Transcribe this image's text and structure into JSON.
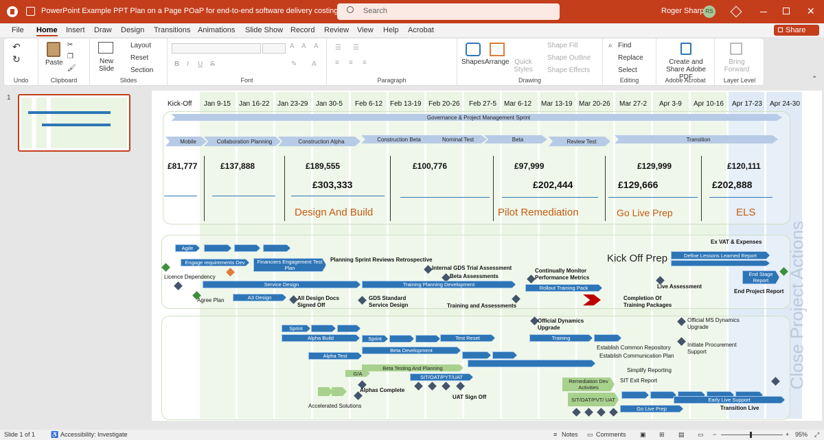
{
  "titlebar": {
    "doc_title": "PowerPoint  Example PPT Plan on a Page POaP for end-to-end software delivery costing  -  PowerPoint",
    "search_placeholder": "Search",
    "user_name": "Roger Sharp",
    "user_initials": "RS"
  },
  "menu": {
    "tabs": [
      "File",
      "Home",
      "Insert",
      "Draw",
      "Design",
      "Transitions",
      "Animations",
      "Slide Show",
      "Record",
      "Review",
      "View",
      "Help",
      "Acrobat"
    ],
    "share_label": "Share"
  },
  "ribbon": {
    "undo_label": "Undo",
    "clipboard": {
      "paste": "Paste",
      "group": "Clipboard"
    },
    "slides": {
      "new_slide": "New Slide",
      "layout": "Layout",
      "reset": "Reset",
      "section": "Section",
      "group": "Slides"
    },
    "font": {
      "group": "Font"
    },
    "paragraph": {
      "group": "Paragraph"
    },
    "drawing": {
      "shapes": "Shapes",
      "arrange": "Arrange",
      "quick_styles": "Quick Styles",
      "shape_fill": "Shape Fill",
      "shape_outline": "Shape Outline",
      "shape_effects": "Shape Effects",
      "group": "Drawing"
    },
    "editing": {
      "find": "Find",
      "replace": "Replace",
      "select": "Select",
      "group": "Editing"
    },
    "acrobat": {
      "create": "Create and Share Adobe PDF",
      "group": "Adobe Acrobat"
    },
    "layer": {
      "bring_forward": "Bring Forward",
      "group": "Layer Level"
    }
  },
  "thumb": {
    "number": "1"
  },
  "slide": {
    "headers": [
      "Kick-Off",
      "Jan 9-15",
      "Jan 16-22",
      "Jan 23-29",
      "Jan 30-5",
      "Feb 6-12",
      "Feb 13-19",
      "Feb 20-26",
      "Feb 27-5",
      "Mar 6-12",
      "Mar 13-19",
      "Mar 20-26",
      "Mar 27-2",
      "Apr 3-9",
      "Apr 10-16",
      "Apr 17-23",
      "Apr 24-30"
    ],
    "governance": "Governance & Project Management Sprint",
    "phases_row": [
      "Mobile",
      "Collaboration Planning",
      "Construction Alpha",
      "Construction Beta",
      "Nominal Test",
      "Beta",
      "Review Test",
      "Transition"
    ],
    "costs_small": [
      "£81,777",
      "£137,888",
      "£189,555",
      "£100,776",
      "£97,999",
      "£129,999",
      "£120,111"
    ],
    "costs_big": [
      "£303,333",
      "£202,444",
      "£129,666",
      "£202,888"
    ],
    "phase_names": [
      "Design And Build",
      "Pilot Remediation",
      "Go Live Prep",
      "ELS"
    ],
    "watermark": "Close Project Actions",
    "mid": {
      "agile": "Agile",
      "engage": "Engage requirements Dev",
      "financiers": "Financiers Engagement Test Plan",
      "planning_sprint": "Planning Sprint Reviews Retrospective",
      "licence": "Licence Dependency",
      "service_design": "Service Design",
      "internal_gds": "Internal GDS Trial Assessment",
      "beta_assess": "Beta Assessments",
      "training_planning": "Training Planning Development",
      "monitor": "Continually Monitor Performance Metrics",
      "rollout": "Rollout Training Pack",
      "kickoff_prep": "Kick Off Prep",
      "lessons": "Define Lessons Learned Report",
      "vat": "Ex VAT & Expenses",
      "live_assess": "Live Assessment",
      "end_stage": "End Stage Report",
      "end_project": "End Project Report",
      "agree_plan": "Agree Plan",
      "a3": "A3 Design",
      "all_design": "All Design Docs Signed Off",
      "gds_standard": "GDS Standard Service Design",
      "training_assess": "Training and Assessments",
      "completion": "Completion Of Training Packages"
    },
    "bottom": {
      "sprint": "Sprint",
      "alpha_build": "Alpha Build",
      "sprint2": "Sprint",
      "test_reset": "Test Reset",
      "alpha_test": "Alpha Test",
      "beta_dev": "Beta Development",
      "beta_testing": "Beta Testing And Planning",
      "ga": "G/A",
      "sit1": "SIT/OAT/PYT/UAT",
      "alphas_complete": "Alphas Complete",
      "uat_signoff": "UAT Sign Off",
      "accelerated": "Accelerated Solutions",
      "dynamics": "Official Dynamics Upgrade",
      "training": "Training",
      "common_repo": "Establish Common Repository",
      "comm_plan": "Establish Communication Plan",
      "official_ms": "Official MS Dynamics Upgrade",
      "procurement": "Initiate Procurement Support",
      "simplify": "Simplify Reporting",
      "remediation": "Remediation Dev Activities",
      "sit_exit": "SIT Exit Report",
      "sit2": "SIT/OAT/PVT/ UAT",
      "early_live": "Early Live Support",
      "go_live_prep": "Go Live Prep",
      "transition_live": "Transition Live"
    }
  },
  "status": {
    "slide_of": "Slide 1 of 1",
    "accessibility": "Accessibility: Investigate",
    "notes": "Notes",
    "comments": "Comments",
    "zoom": "95%"
  }
}
